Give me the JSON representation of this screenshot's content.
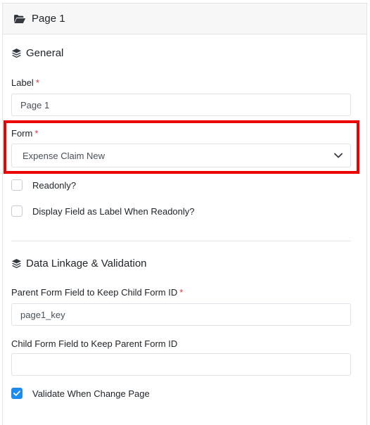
{
  "header": {
    "title": "Page 1",
    "icon": "folder-open-icon"
  },
  "general": {
    "title": "General",
    "icon": "layers-icon",
    "label_field": {
      "label": "Label",
      "required": "*",
      "value": "Page 1"
    },
    "form_field": {
      "label": "Form",
      "required": "*",
      "selected": "Expense Claim New"
    },
    "readonly": {
      "label": "Readonly?",
      "checked": false
    },
    "display_as_label": {
      "label": "Display Field as Label When Readonly?",
      "checked": false
    }
  },
  "linkage": {
    "title": "Data Linkage & Validation",
    "icon": "layers-icon",
    "parent_field": {
      "label": "Parent Form Field to Keep Child Form ID",
      "required": "*",
      "value": "page1_key"
    },
    "child_field": {
      "label": "Child Form Field to Keep Parent Form ID",
      "value": ""
    },
    "validate": {
      "label": "Validate When Change Page",
      "checked": true
    }
  },
  "colors": {
    "accent": "#1d8cf0",
    "highlight": "#ef0000",
    "required": "#dc3545"
  }
}
